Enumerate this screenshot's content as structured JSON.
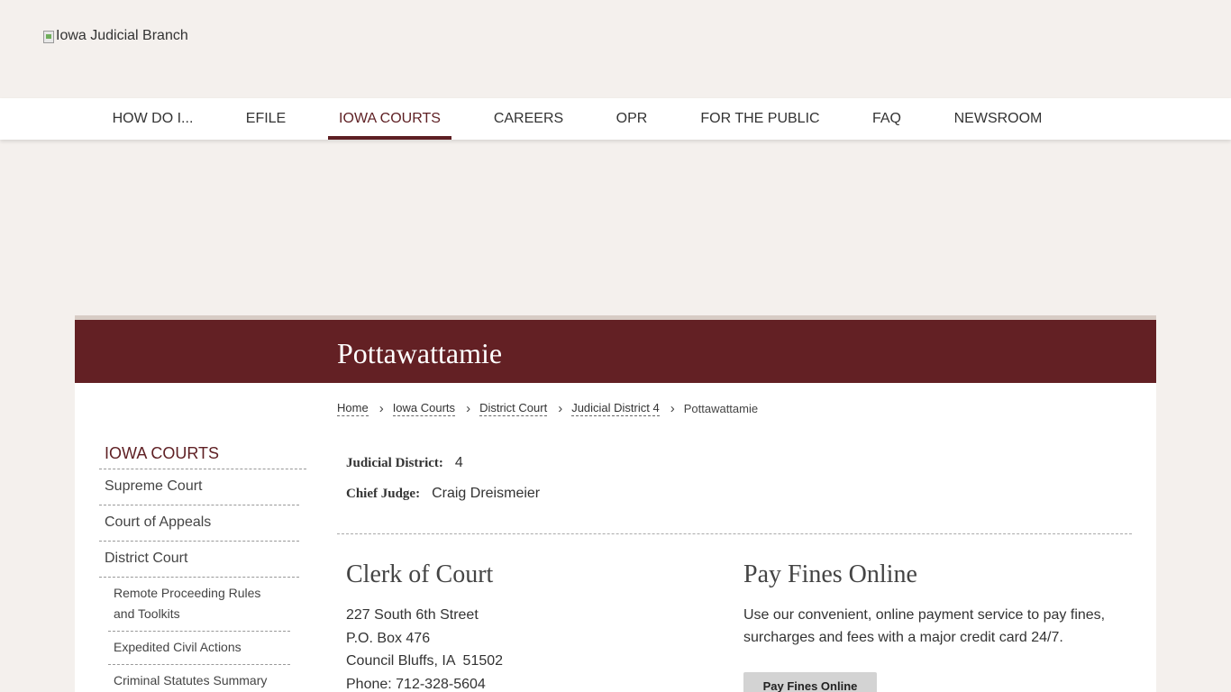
{
  "header": {
    "logo_alt": "Iowa Judicial Branch"
  },
  "nav": {
    "items": [
      {
        "label": "HOW DO I..."
      },
      {
        "label": "EFILE"
      },
      {
        "label": "IOWA COURTS"
      },
      {
        "label": "CAREERS"
      },
      {
        "label": "OPR"
      },
      {
        "label": "FOR THE PUBLIC"
      },
      {
        "label": "FAQ"
      },
      {
        "label": "NEWSROOM"
      }
    ],
    "active": "IOWA COURTS"
  },
  "page": {
    "title": "Pottawattamie"
  },
  "breadcrumb": {
    "items": [
      "Home",
      "Iowa Courts",
      "District Court",
      "Judicial District 4"
    ],
    "current": "Pottawattamie"
  },
  "sidebar": {
    "heading": "IOWA COURTS",
    "items": [
      "Supreme Court",
      "Court of Appeals",
      "District Court"
    ],
    "subitems": [
      "Remote Proceeding Rules and Toolkits",
      "Expedited Civil Actions",
      "Criminal Statutes Summary"
    ]
  },
  "info": {
    "district_label": "Judicial District:",
    "district_value": "4",
    "judge_label": "Chief Judge:",
    "judge_value": "Craig Dreismeier"
  },
  "clerk": {
    "heading": "Clerk of Court",
    "lines": [
      "227 South 6th Street",
      "P.O. Box 476",
      "Council Bluffs, IA  51502",
      "Phone: 712-328-5604"
    ]
  },
  "fines": {
    "heading": "Pay Fines Online",
    "text": "Use our convenient, online payment service to pay fines, surcharges and fees with a major credit card 24/7.",
    "button_label": "Pay Fines Online"
  },
  "colors": {
    "brand": "#632024",
    "accent": "#5e1f23",
    "page_bg": "#f4f0ed"
  }
}
